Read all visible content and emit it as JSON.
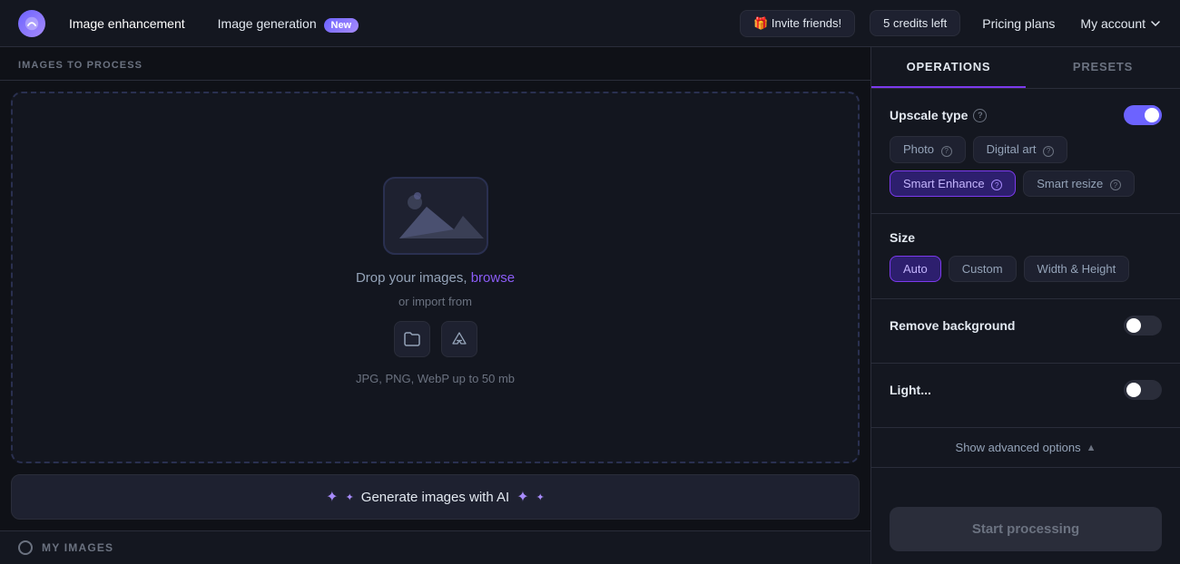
{
  "topnav": {
    "logo_alt": "Logo",
    "tab_enhancement": "Image enhancement",
    "tab_generation": "Image generation",
    "new_badge": "New",
    "invite_label": "🎁 Invite friends!",
    "credits_label": "5 credits left",
    "pricing_label": "Pricing plans",
    "account_label": "My account"
  },
  "left": {
    "section_label": "IMAGES TO PROCESS",
    "drop_text_1": "Drop your images,",
    "browse_text": "browse",
    "import_text": "or import from",
    "format_text": "JPG, PNG, WebP up to 50 mb",
    "generate_label": "Generate images with AI",
    "my_images_label": "MY IMAGES"
  },
  "right": {
    "tab_operations": "OPERATIONS",
    "tab_presets": "PRESETS",
    "upscale_label": "Upscale type",
    "chips": [
      {
        "label": "Photo",
        "active": false
      },
      {
        "label": "Digital art",
        "active": false
      },
      {
        "label": "Smart Enhance",
        "active": true
      },
      {
        "label": "Smart resize",
        "active": false
      }
    ],
    "size_label": "Size",
    "size_chips": [
      {
        "label": "Auto",
        "active": true
      },
      {
        "label": "Custom",
        "active": false
      },
      {
        "label": "Width & Height",
        "active": false
      }
    ],
    "remove_bg_label": "Remove background",
    "advanced_label": "Show advanced options",
    "start_label": "Start processing"
  }
}
